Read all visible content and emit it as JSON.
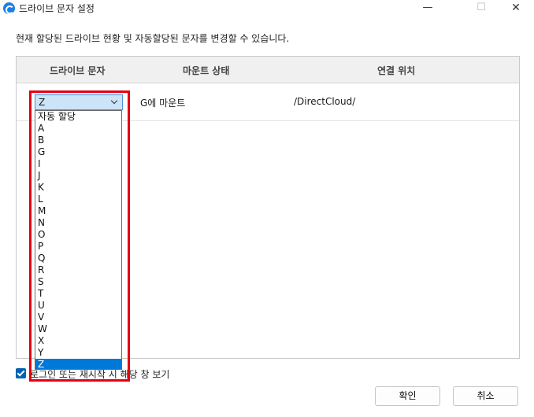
{
  "window": {
    "title": "드라이브 문자 설정",
    "minimize_glyph": "—",
    "maximize_glyph": "☐",
    "close_glyph": "✕"
  },
  "description": "현재 할당된 드라이브 현황 및 자동할당된 문자를 변경할 수 있습니다.",
  "table": {
    "headers": [
      "드라이브 문자",
      "마운트 상태",
      "연결 위치"
    ],
    "rows": [
      {
        "drive_letter": "Z",
        "mount_status": "G에 마운트",
        "location": "/DirectCloud/"
      }
    ]
  },
  "dropdown": {
    "selected": "Z",
    "options": [
      "자동 할당",
      "A",
      "B",
      "G",
      "I",
      "J",
      "K",
      "L",
      "M",
      "N",
      "O",
      "P",
      "Q",
      "R",
      "S",
      "T",
      "U",
      "V",
      "W",
      "X",
      "Y",
      "Z"
    ]
  },
  "checkbox": {
    "label": "로그인 또는 재시작 시 해당 창 보기",
    "checked": true
  },
  "buttons": {
    "ok_label": "확인",
    "cancel_label": "취소"
  },
  "colors": {
    "accent": "#0078d7",
    "highlight_frame": "#e50012",
    "app_icon": "#1c7fe3"
  }
}
